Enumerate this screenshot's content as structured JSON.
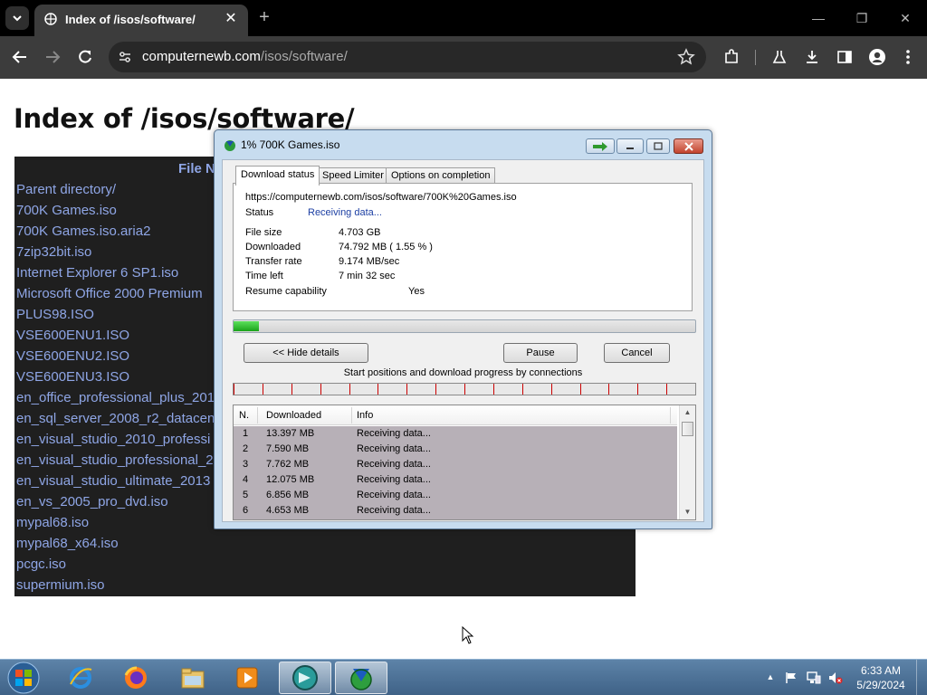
{
  "browser": {
    "tab_title": "Index of /isos/software/",
    "url_host": "computernewb.com",
    "url_path": "/isos/software/"
  },
  "page": {
    "heading": "Index of /isos/software/",
    "column_header": "File N",
    "files": [
      "Parent directory/",
      "700K Games.iso",
      "700K Games.iso.aria2",
      "7zip32bit.iso",
      "Internet Explorer 6 SP1.iso",
      "Microsoft Office 2000 Premium",
      "PLUS98.ISO",
      "VSE600ENU1.ISO",
      "VSE600ENU2.ISO",
      "VSE600ENU3.ISO",
      "en_office_professional_plus_201",
      "en_sql_server_2008_r2_datacen",
      "en_visual_studio_2010_professi",
      "en_visual_studio_professional_2",
      "en_visual_studio_ultimate_2013",
      "en_vs_2005_pro_dvd.iso",
      "mypal68.iso",
      "mypal68_x64.iso",
      "pcgc.iso",
      "supermium.iso"
    ]
  },
  "dialog": {
    "title": "1% 700K Games.iso",
    "tabs": [
      "Download status",
      "Speed Limiter",
      "Options on completion"
    ],
    "url": "https://computernewb.com/isos/software/700K%20Games.iso",
    "status_label": "Status",
    "status_value": "Receiving data...",
    "file_size_label": "File size",
    "file_size_value": "4.703  GB",
    "downloaded_label": "Downloaded",
    "downloaded_value": "74.792  MB  ( 1.55 % )",
    "transfer_rate_label": "Transfer rate",
    "transfer_rate_value": "9.174  MB/sec",
    "time_left_label": "Time left",
    "time_left_value": "7 min 32 sec",
    "resume_label": "Resume capability",
    "resume_value": "Yes",
    "progress_fraction": 0.0155,
    "hide_details_button": "<< Hide details",
    "pause_button": "Pause",
    "cancel_button": "Cancel",
    "connections_caption": "Start positions and download progress by connections",
    "table_headers": [
      "N.",
      "Downloaded",
      "Info"
    ],
    "connections": [
      {
        "n": "1",
        "downloaded": "13.397  MB",
        "info": "Receiving data..."
      },
      {
        "n": "2",
        "downloaded": "7.590  MB",
        "info": "Receiving data..."
      },
      {
        "n": "3",
        "downloaded": "7.762  MB",
        "info": "Receiving data..."
      },
      {
        "n": "4",
        "downloaded": "12.075  MB",
        "info": "Receiving data..."
      },
      {
        "n": "5",
        "downloaded": "6.856  MB",
        "info": "Receiving data..."
      },
      {
        "n": "6",
        "downloaded": "4.653  MB",
        "info": "Receiving data..."
      }
    ]
  },
  "taskbar": {
    "apps": [
      "ie-icon",
      "firefox-icon",
      "explorer-icon",
      "media-player-icon",
      "vm-app-icon",
      "idm-icon"
    ],
    "time": "6:33 AM",
    "date": "5/29/2024"
  }
}
